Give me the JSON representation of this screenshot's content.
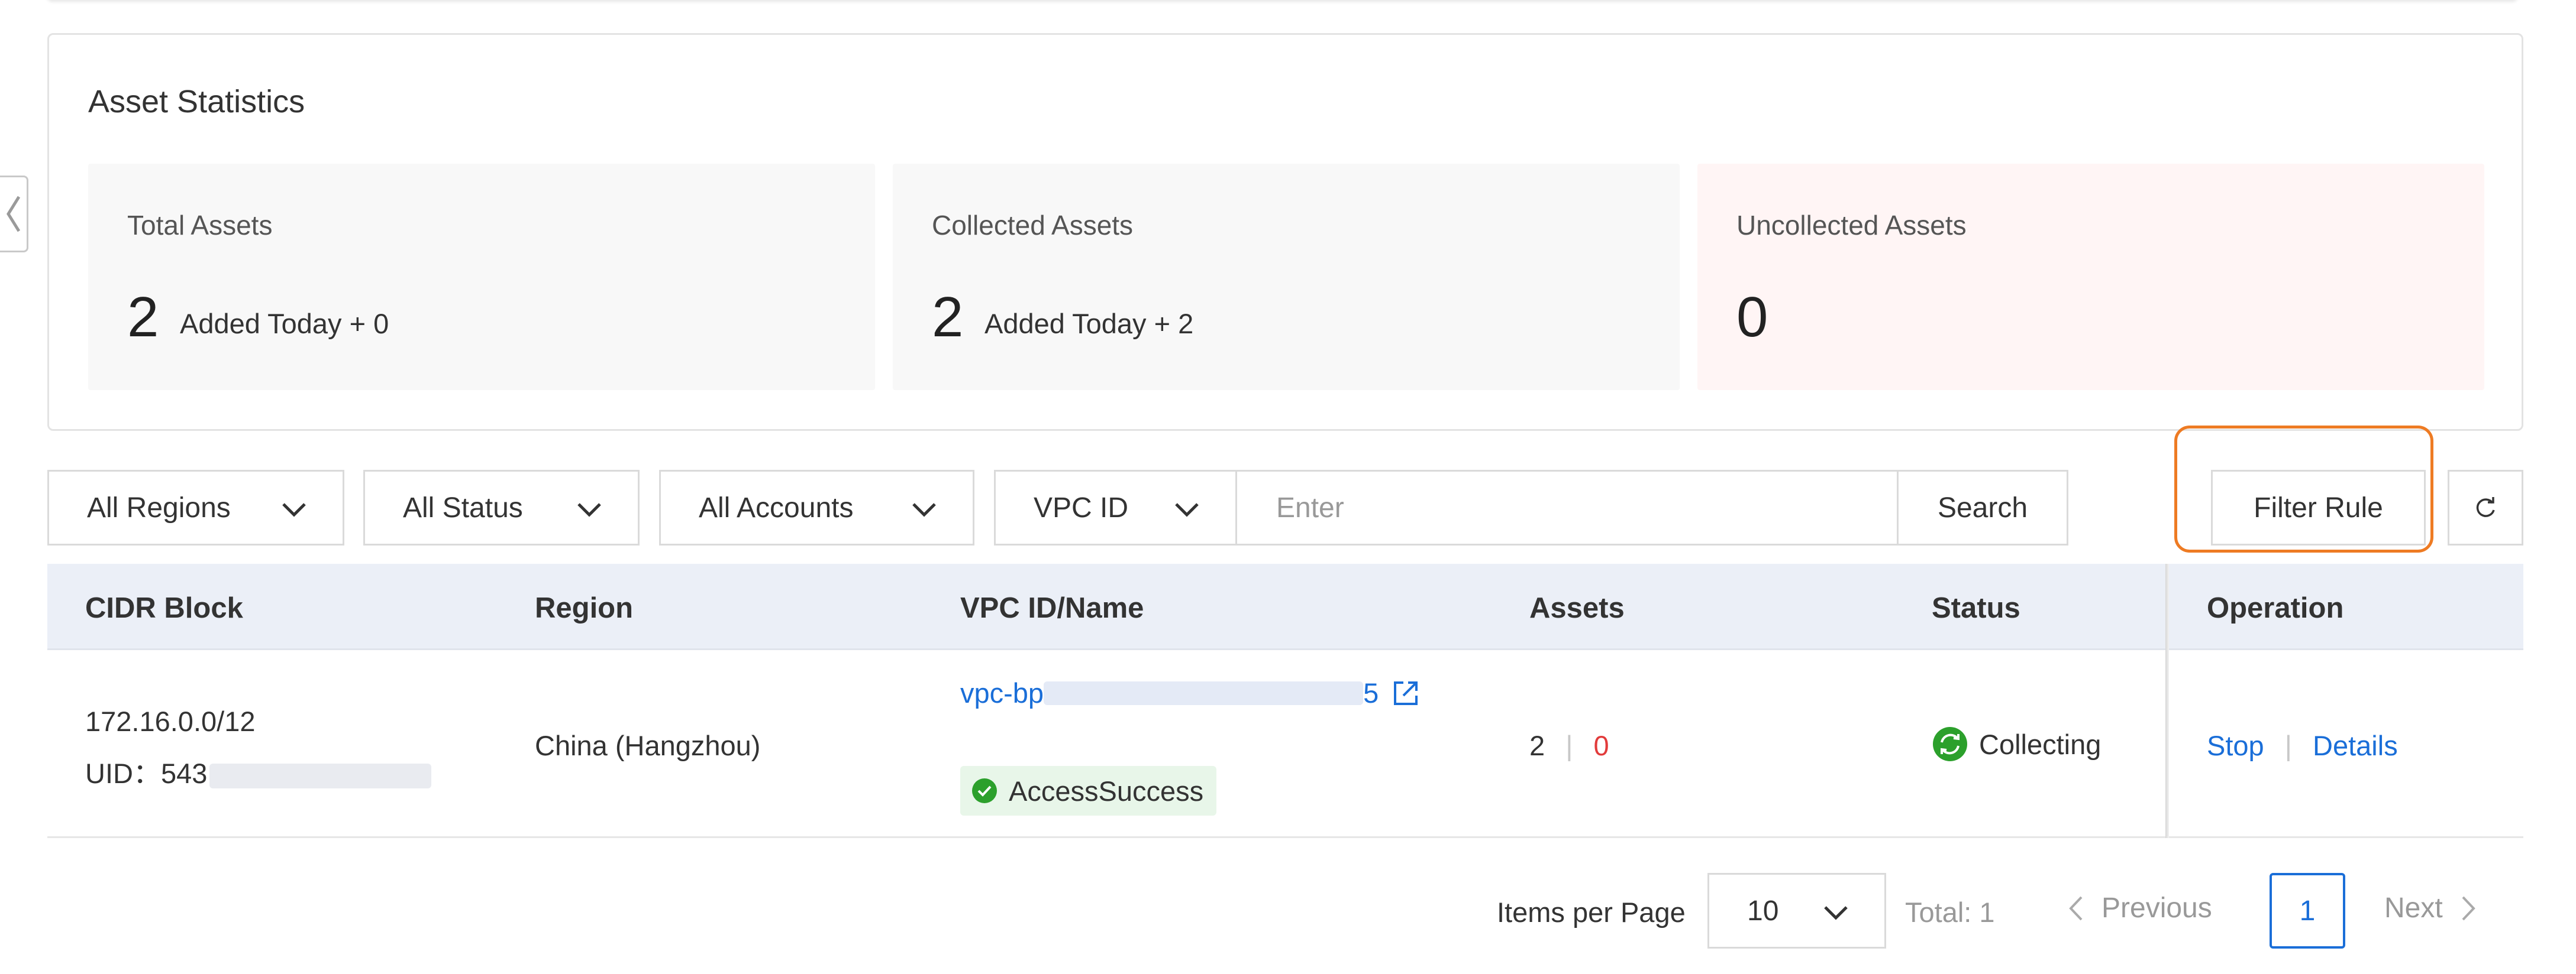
{
  "stats": {
    "title": "Asset Statistics",
    "cards": [
      {
        "label": "Total Assets",
        "value": "2",
        "sub": "Added Today + 0"
      },
      {
        "label": "Collected Assets",
        "value": "2",
        "sub": "Added Today + 2"
      },
      {
        "label": "Uncollected Assets",
        "value": "0",
        "sub": ""
      }
    ]
  },
  "filters": {
    "region": "All Regions",
    "status": "All Status",
    "accounts": "All Accounts",
    "vpc_type": "VPC ID",
    "search_placeholder": "Enter",
    "search_label": "Search",
    "filter_rule_label": "Filter Rule"
  },
  "table": {
    "columns": [
      "CIDR Block",
      "Region",
      "VPC ID/Name",
      "Assets",
      "Status",
      "Operation"
    ],
    "rows": [
      {
        "cidr": "172.16.0.0/12",
        "uid_prefix": "UID：543",
        "region": "China (Hangzhou)",
        "vpc_prefix": "vpc-bp",
        "vpc_suffix": "5",
        "access": "AccessSuccess",
        "assets_collected": "2",
        "assets_separator": "|",
        "assets_uncollected": "0",
        "status": "Collecting",
        "op_stop": "Stop",
        "op_separator": "|",
        "op_details": "Details"
      }
    ]
  },
  "pagination": {
    "items_per_page_label": "Items per Page",
    "page_size": "10",
    "total": "Total: 1",
    "previous": "Previous",
    "current_page": "1",
    "next": "Next"
  },
  "colors": {
    "accent": "#1a6ed8",
    "success": "#2ca02c",
    "danger": "#e23b3b",
    "highlight": "#ee7b23"
  }
}
